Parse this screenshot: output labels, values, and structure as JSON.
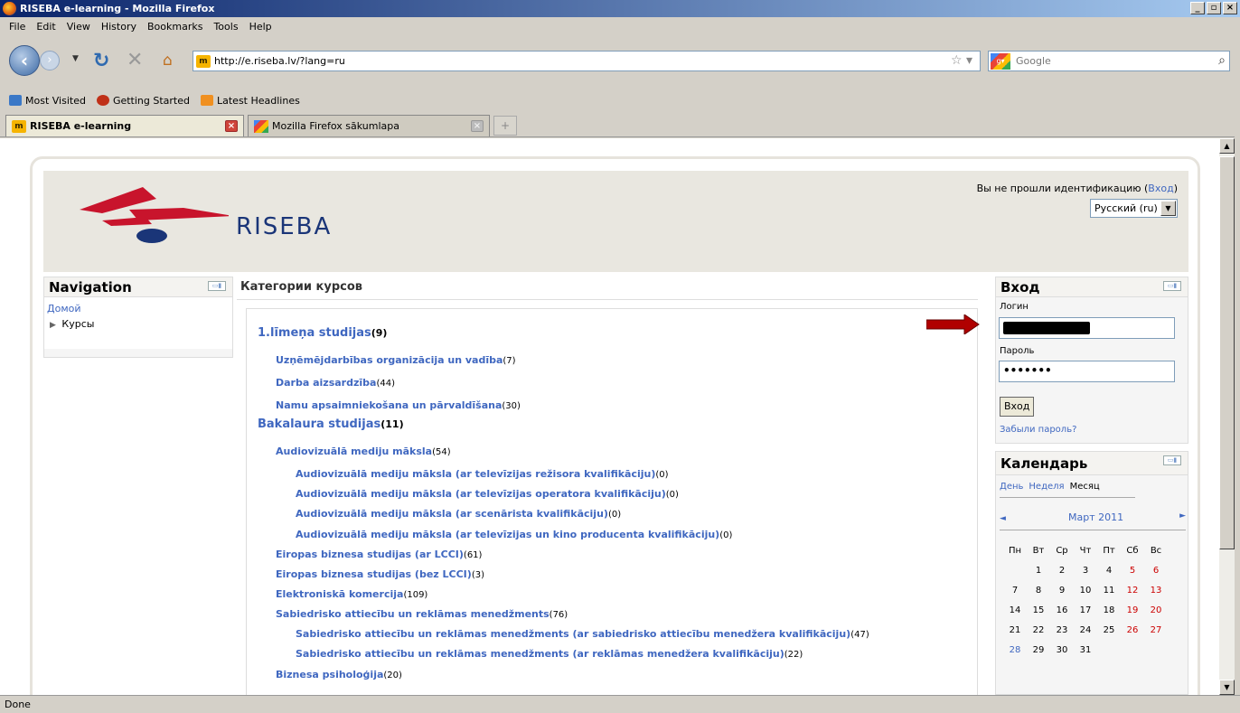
{
  "window": {
    "title": "RISEBA e-learning - Mozilla Firefox",
    "controls": [
      "_",
      "×"
    ]
  },
  "menu": [
    "File",
    "Edit",
    "View",
    "History",
    "Bookmarks",
    "Tools",
    "Help"
  ],
  "toolbar": {
    "url": "http://e.riseba.lv/?lang=ru",
    "search_placeholder": "Google"
  },
  "bookmarks": [
    {
      "label": "Most Visited",
      "icon": "most-visited-icon",
      "color": "#3b78c7"
    },
    {
      "label": "Getting Started",
      "icon": "firefox-getting-started-icon",
      "color": "#c03018"
    },
    {
      "label": "Latest Headlines",
      "icon": "rss-feed-icon",
      "color": "#f09020"
    }
  ],
  "tabs": [
    {
      "label": "RISEBA e-learning",
      "active": true
    },
    {
      "label": "Mozilla Firefox sākumlapa",
      "active": false
    }
  ],
  "status": "Done",
  "site": {
    "logo_text": "RISEBA",
    "login_prefix": "Вы не прошли идентификацию (",
    "login_link": "Вход",
    "login_suffix": ")",
    "language": "Русский (ru)"
  },
  "navigation": {
    "title": "Navigation",
    "home": "Домой",
    "courses": "Курсы"
  },
  "main": {
    "title": "Категории курсов",
    "categories": [
      {
        "name": "1.līmeņa studijas",
        "count": "(9)",
        "level": 0
      },
      {
        "name": "Uzņēmējdarbības organizācija un vadība",
        "count": "(7)",
        "level": 1
      },
      {
        "name": "Darba aizsardzība",
        "count": "(44)",
        "level": 1
      },
      {
        "name": "Namu apsaimniekošana un pārvaldīšana",
        "count": "(30)",
        "level": 1
      },
      {
        "name": "Bakalaura studijas",
        "count": "(11)",
        "level": 0
      },
      {
        "name": "Audiovizuālā mediju māksla",
        "count": "(54)",
        "level": 1
      },
      {
        "name": "Audiovizuālā mediju māksla (ar televīzijas režisora kvalifikāciju)",
        "count": "(0)",
        "level": 2
      },
      {
        "name": "Audiovizuālā mediju māksla (ar televīzijas operatora kvalifikāciju)",
        "count": "(0)",
        "level": 2
      },
      {
        "name": "Audiovizuālā mediju māksla (ar scenārista kvalifikāciju)",
        "count": "(0)",
        "level": 2
      },
      {
        "name": "Audiovizuālā mediju māksla (ar televīzijas un kino producenta kvalifikāciju)",
        "count": "(0)",
        "level": 2
      },
      {
        "name": "Eiropas biznesa studijas (ar LCCI)",
        "count": "(61)",
        "level": 1
      },
      {
        "name": "Eiropas biznesa studijas (bez LCCI)",
        "count": "(3)",
        "level": 1
      },
      {
        "name": "Elektroniskā komercija",
        "count": "(109)",
        "level": 1
      },
      {
        "name": "Sabiedrisko attiecību un reklāmas menedžments",
        "count": "(76)",
        "level": 1
      },
      {
        "name": "Sabiedrisko attiecību un reklāmas menedžments (ar sabiedrisko attiecību menedžera kvalifikāciju)",
        "count": "(47)",
        "level": 2
      },
      {
        "name": "Sabiedrisko attiecību un reklāmas menedžments (ar reklāmas menedžera kvalifikāciju)",
        "count": "(22)",
        "level": 2
      },
      {
        "name": "Biznesa psiholoģija",
        "count": "(20)",
        "level": 1
      }
    ]
  },
  "login": {
    "title": "Вход",
    "username_label": "Логин",
    "password_label": "Пароль",
    "password_value": "•••••••",
    "submit": "Вход",
    "forgot": "Забыли пароль?"
  },
  "calendar": {
    "title": "Календарь",
    "views": [
      "День",
      "Неделя",
      "Месяц"
    ],
    "month": "Март 2011",
    "prev": "◄",
    "next": "►",
    "weekdays": [
      "Пн",
      "Вт",
      "Ср",
      "Чт",
      "Пт",
      "Сб",
      "Вс"
    ],
    "weeks": [
      [
        "",
        "1",
        "2",
        "3",
        "4",
        "5",
        "6"
      ],
      [
        "7",
        "8",
        "9",
        "10",
        "11",
        "12",
        "13"
      ],
      [
        "14",
        "15",
        "16",
        "17",
        "18",
        "19",
        "20"
      ],
      [
        "21",
        "22",
        "23",
        "24",
        "25",
        "26",
        "27"
      ],
      [
        "28",
        "29",
        "30",
        "31",
        "",
        "",
        ""
      ]
    ],
    "today": "28"
  },
  "colors": {
    "link": "#3f67c0",
    "header_bg": "#e9e7e0",
    "logo_red": "#c8142c",
    "logo_blue": "#1a3578",
    "arrow_red": "#b00000"
  }
}
